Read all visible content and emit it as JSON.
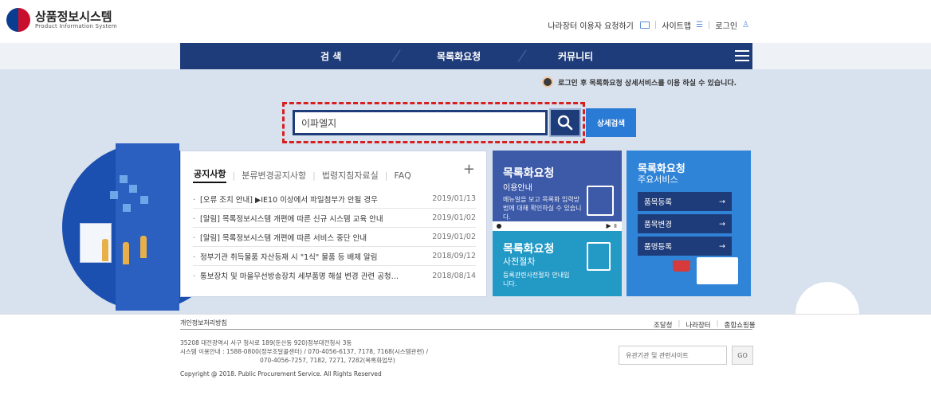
{
  "header": {
    "logo_title": "상품정보시스템",
    "logo_subtitle": "Product Information System",
    "util": {
      "request": "나라장터 이용자 요청하기",
      "sitemap": "사이트맵",
      "login": "로그인"
    }
  },
  "nav": {
    "items": [
      "검  색",
      "목록화요청",
      "커뮤니티"
    ]
  },
  "login_note": "로그인 후 목록화요청 상세서비스를 이용 하실 수 있습니다.",
  "search": {
    "value": "이파엘지",
    "detail_label": "상세검색"
  },
  "notice": {
    "tabs": [
      "공지사항",
      "분류변경공지사항",
      "법령지침자료실",
      "FAQ"
    ],
    "more": "+",
    "items": [
      {
        "title": "[오류 조치 안내] ▶IE10 이상에서 파일첨부가 안될 경우",
        "date": "2019/01/13"
      },
      {
        "title": "[알림] 목록정보시스템 개편에 따른 신규 시스템 교육 안내",
        "date": "2019/01/02"
      },
      {
        "title": "[알림] 목록정보시스템 개편에 따른 서비스 중단 안내",
        "date": "2019/01/02"
      },
      {
        "title": "정부기관 취득물품 자산등재 시 \"1식\" 물품 등 배제 알림",
        "date": "2018/09/12"
      },
      {
        "title": "통보장치 및 마을무선방송장치 세부품명 해설 변경 관련 공청…",
        "date": "2018/08/14"
      }
    ]
  },
  "card_guide": {
    "title": "목록화요청",
    "subtitle": "이용안내",
    "desc": "메뉴얼을 보고 목록화 입력방법에 대해 확인하실 수 있습니다.",
    "controls": "▶ ॥"
  },
  "card_pre": {
    "title": "목록화요청",
    "subtitle": "사전절차",
    "desc": "등록관련사전절차 안내입니다."
  },
  "card_services": {
    "title": "목록화요청",
    "subtitle": "주요서비스",
    "items": [
      "품목등록",
      "품목변경",
      "품명등록"
    ],
    "arrow": "→"
  },
  "footer": {
    "privacy": "개인정보처리방침",
    "links": [
      "조달청",
      "나라장터",
      "종합쇼핑몰"
    ],
    "address1": "35208 대전광역시 서구 청사로 189(둔산동 920)정부대전청사 3동",
    "address2": "시스템 이용안내 : 1588-0800(정부조달콜센터) / 070-4056-6137, 7178, 7168(시스템관련) /",
    "address3": "070-4056-7257, 7182, 7271, 7282(목록화업무)",
    "copyright": "Copyright @ 2018. Public Procurement Service. All Rights Reserved",
    "related_placeholder": "유관기관 및 관련사이트",
    "go_label": "GO"
  },
  "colors": {
    "nav": "#1f3c7a",
    "accent": "#2a7bd6",
    "highlight": "#d61f1f"
  }
}
